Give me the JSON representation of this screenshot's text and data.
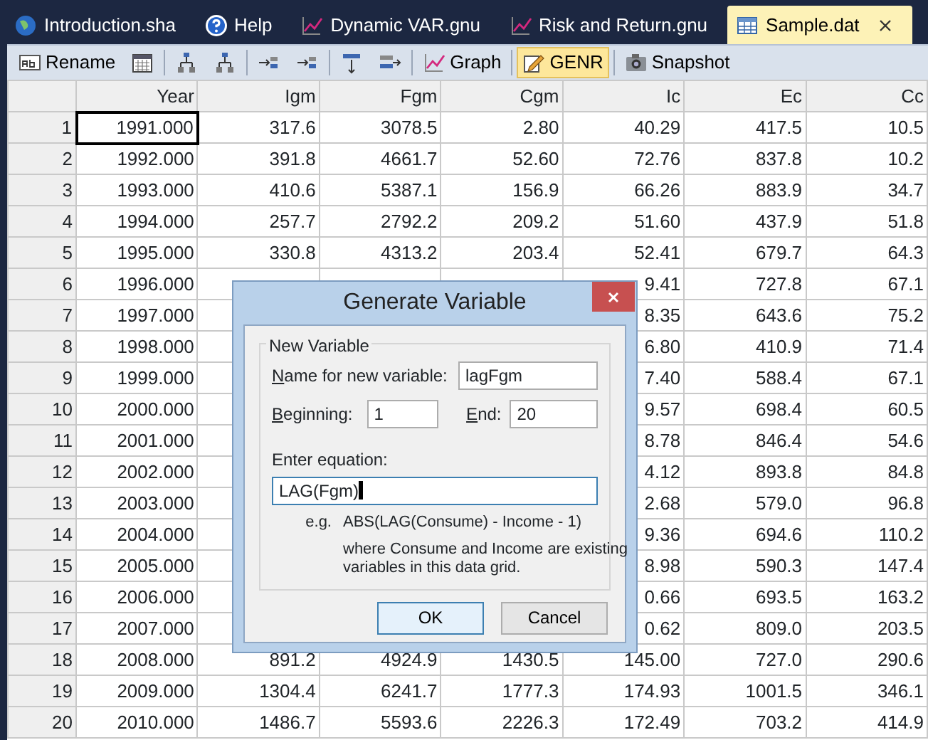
{
  "tabs": [
    {
      "label": "Introduction.sha",
      "kind": "script",
      "selected": false
    },
    {
      "label": "Help",
      "kind": "help",
      "selected": false
    },
    {
      "label": "Dynamic VAR.gnu",
      "kind": "graph",
      "selected": false
    },
    {
      "label": "Risk and Return.gnu",
      "kind": "graph",
      "selected": false
    },
    {
      "label": "Sample.dat",
      "kind": "data",
      "selected": true
    }
  ],
  "toolbar": [
    {
      "kind": "rename",
      "label": "Rename",
      "selected": false
    },
    {
      "kind": "calendar",
      "selected": false
    },
    {
      "kind": "separator"
    },
    {
      "kind": "tree",
      "selected": false
    },
    {
      "kind": "tree",
      "selected": false
    },
    {
      "kind": "separator"
    },
    {
      "kind": "move",
      "selected": false
    },
    {
      "kind": "move",
      "selected": false
    },
    {
      "kind": "separator"
    },
    {
      "kind": "split",
      "selected": false
    },
    {
      "kind": "arrowbar",
      "selected": false
    },
    {
      "kind": "separator"
    },
    {
      "kind": "graph",
      "label": "Graph",
      "selected": false
    },
    {
      "kind": "separator"
    },
    {
      "kind": "genr",
      "label": "GENR",
      "selected": true
    },
    {
      "kind": "separator"
    },
    {
      "kind": "camera",
      "label": "Snapshot",
      "selected": false
    }
  ],
  "grid": {
    "columns": [
      "Year",
      "Igm",
      "Fgm",
      "Cgm",
      "Ic",
      "Ec",
      "Cc"
    ],
    "rows": [
      {
        "label": "1",
        "current": true,
        "cells": [
          "1991.000",
          "317.6",
          "3078.5",
          "2.80",
          "40.29",
          "417.5",
          "10.5"
        ]
      },
      {
        "label": "2",
        "current": false,
        "cells": [
          "1992.000",
          "391.8",
          "4661.7",
          "52.60",
          "72.76",
          "837.8",
          "10.2"
        ]
      },
      {
        "label": "3",
        "current": false,
        "cells": [
          "1993.000",
          "410.6",
          "5387.1",
          "156.9",
          "66.26",
          "883.9",
          "34.7"
        ]
      },
      {
        "label": "4",
        "current": false,
        "cells": [
          "1994.000",
          "257.7",
          "2792.2",
          "209.2",
          "51.60",
          "437.9",
          "51.8"
        ]
      },
      {
        "label": "5",
        "current": false,
        "cells": [
          "1995.000",
          "330.8",
          "4313.2",
          "203.4",
          "52.41",
          "679.7",
          "64.3"
        ]
      },
      {
        "label": "6",
        "current": false,
        "cells": [
          "1996.000",
          null,
          null,
          null,
          "9.41",
          "727.8",
          "67.1"
        ]
      },
      {
        "label": "7",
        "current": false,
        "cells": [
          "1997.000",
          null,
          null,
          null,
          "8.35",
          "643.6",
          "75.2"
        ]
      },
      {
        "label": "8",
        "current": false,
        "cells": [
          "1998.000",
          null,
          null,
          null,
          "6.80",
          "410.9",
          "71.4"
        ]
      },
      {
        "label": "9",
        "current": false,
        "cells": [
          "1999.000",
          null,
          null,
          null,
          "7.40",
          "588.4",
          "67.1"
        ]
      },
      {
        "label": "10",
        "current": false,
        "cells": [
          "2000.000",
          null,
          null,
          null,
          "9.57",
          "698.4",
          "60.5"
        ]
      },
      {
        "label": "11",
        "current": false,
        "cells": [
          "2001.000",
          null,
          null,
          null,
          "8.78",
          "846.4",
          "54.6"
        ]
      },
      {
        "label": "12",
        "current": false,
        "cells": [
          "2002.000",
          null,
          null,
          null,
          "4.12",
          "893.8",
          "84.8"
        ]
      },
      {
        "label": "13",
        "current": false,
        "cells": [
          "2003.000",
          null,
          null,
          null,
          "2.68",
          "579.0",
          "96.8"
        ]
      },
      {
        "label": "14",
        "current": false,
        "cells": [
          "2004.000",
          null,
          null,
          null,
          "9.36",
          "694.6",
          "110.2"
        ]
      },
      {
        "label": "15",
        "current": false,
        "cells": [
          "2005.000",
          null,
          null,
          null,
          "8.98",
          "590.3",
          "147.4"
        ]
      },
      {
        "label": "16",
        "current": false,
        "cells": [
          "2006.000",
          null,
          null,
          null,
          "0.66",
          "693.5",
          "163.2"
        ]
      },
      {
        "label": "17",
        "current": false,
        "cells": [
          "2007.000",
          null,
          null,
          null,
          "0.62",
          "809.0",
          "203.5"
        ]
      },
      {
        "label": "18",
        "current": false,
        "cells": [
          "2008.000",
          "891.2",
          "4924.9",
          "1430.5",
          "145.00",
          "727.0",
          "290.6"
        ]
      },
      {
        "label": "19",
        "current": false,
        "cells": [
          "2009.000",
          "1304.4",
          "6241.7",
          "1777.3",
          "174.93",
          "1001.5",
          "346.1"
        ]
      },
      {
        "label": "20",
        "current": false,
        "cells": [
          "2010.000",
          "1486.7",
          "5593.6",
          "2226.3",
          "172.49",
          "703.2",
          "414.9"
        ]
      }
    ]
  },
  "dialog": {
    "title": "Generate Variable",
    "group": "New Variable",
    "name_label": "Name for new variable:",
    "name_mnemonic": true,
    "name_value": "lagFgm",
    "beginning_label": "Beginning:",
    "beginning_mnemonic": true,
    "beginning_value": "1",
    "end_label": "End:",
    "end_mnemonic": true,
    "end_value": "20",
    "equation_label": "Enter equation:",
    "equation_value": "LAG(Fgm)",
    "example_prefix": "e.g.",
    "example": "ABS(LAG(Consume) - Income - 1)",
    "example_note": "where Consume and Income are existing variables in this data grid.",
    "buttons": [
      {
        "label": "OK",
        "default": true
      },
      {
        "label": "Cancel",
        "default": false
      }
    ]
  }
}
